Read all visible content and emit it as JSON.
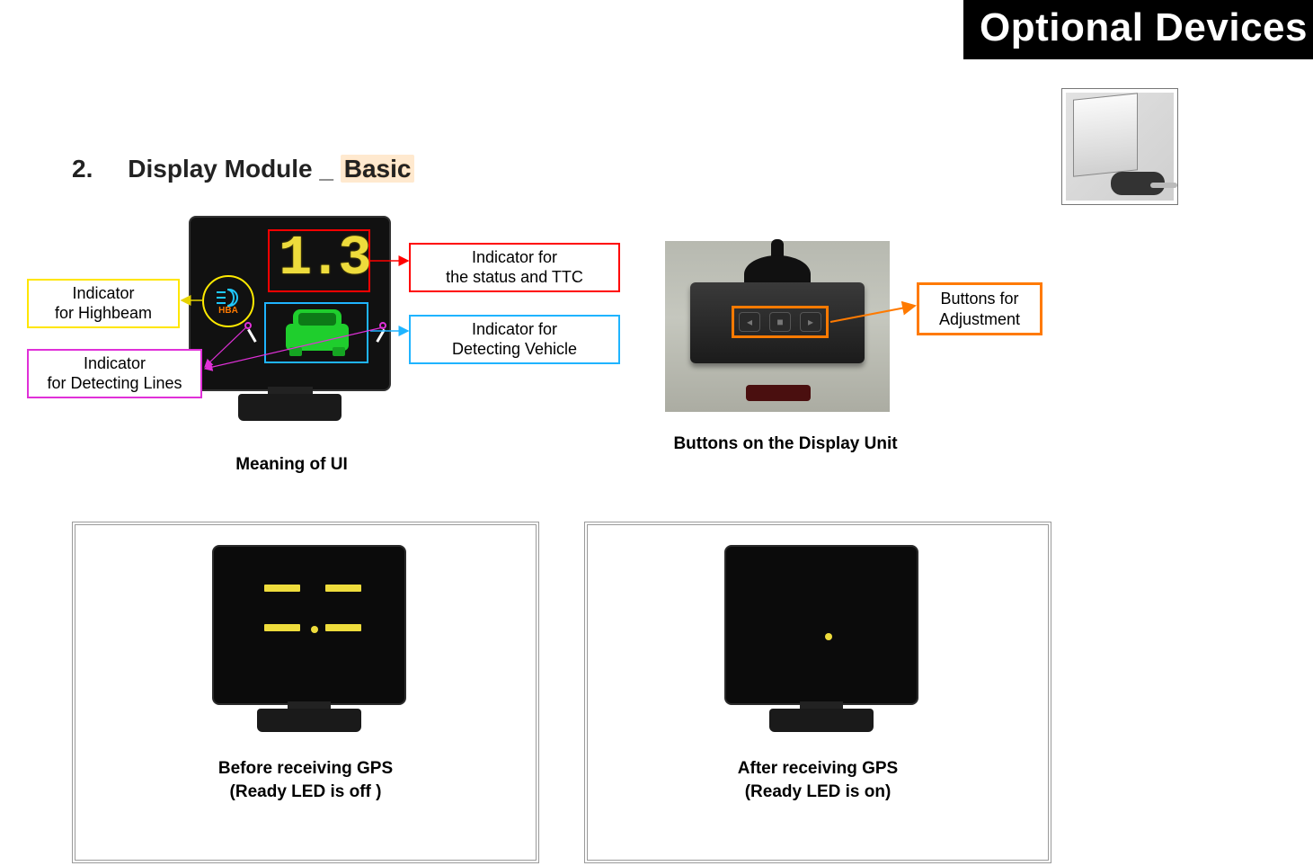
{
  "header": {
    "title": "Optional Devices"
  },
  "section": {
    "number": "2.",
    "title": "Display Module _",
    "highlight": "Basic"
  },
  "ui": {
    "ttc_value": "1.3",
    "hba_label": "HBA"
  },
  "callouts": {
    "highbeam": "Indicator\nfor Highbeam",
    "lines": "Indicator\nfor Detecting Lines",
    "status_ttc": "Indicator for\nthe status and TTC",
    "vehicle": "Indicator for\nDetecting Vehicle",
    "buttons": "Buttons for\nAdjustment"
  },
  "captions": {
    "fig1": "Meaning of UI",
    "fig2": "Buttons on the Display Unit",
    "panel_left_line1": "Before receiving GPS",
    "panel_left_line2": "(Ready LED is off )",
    "panel_right_line1": "After receiving GPS",
    "panel_right_line2": "(Ready LED is on)"
  }
}
